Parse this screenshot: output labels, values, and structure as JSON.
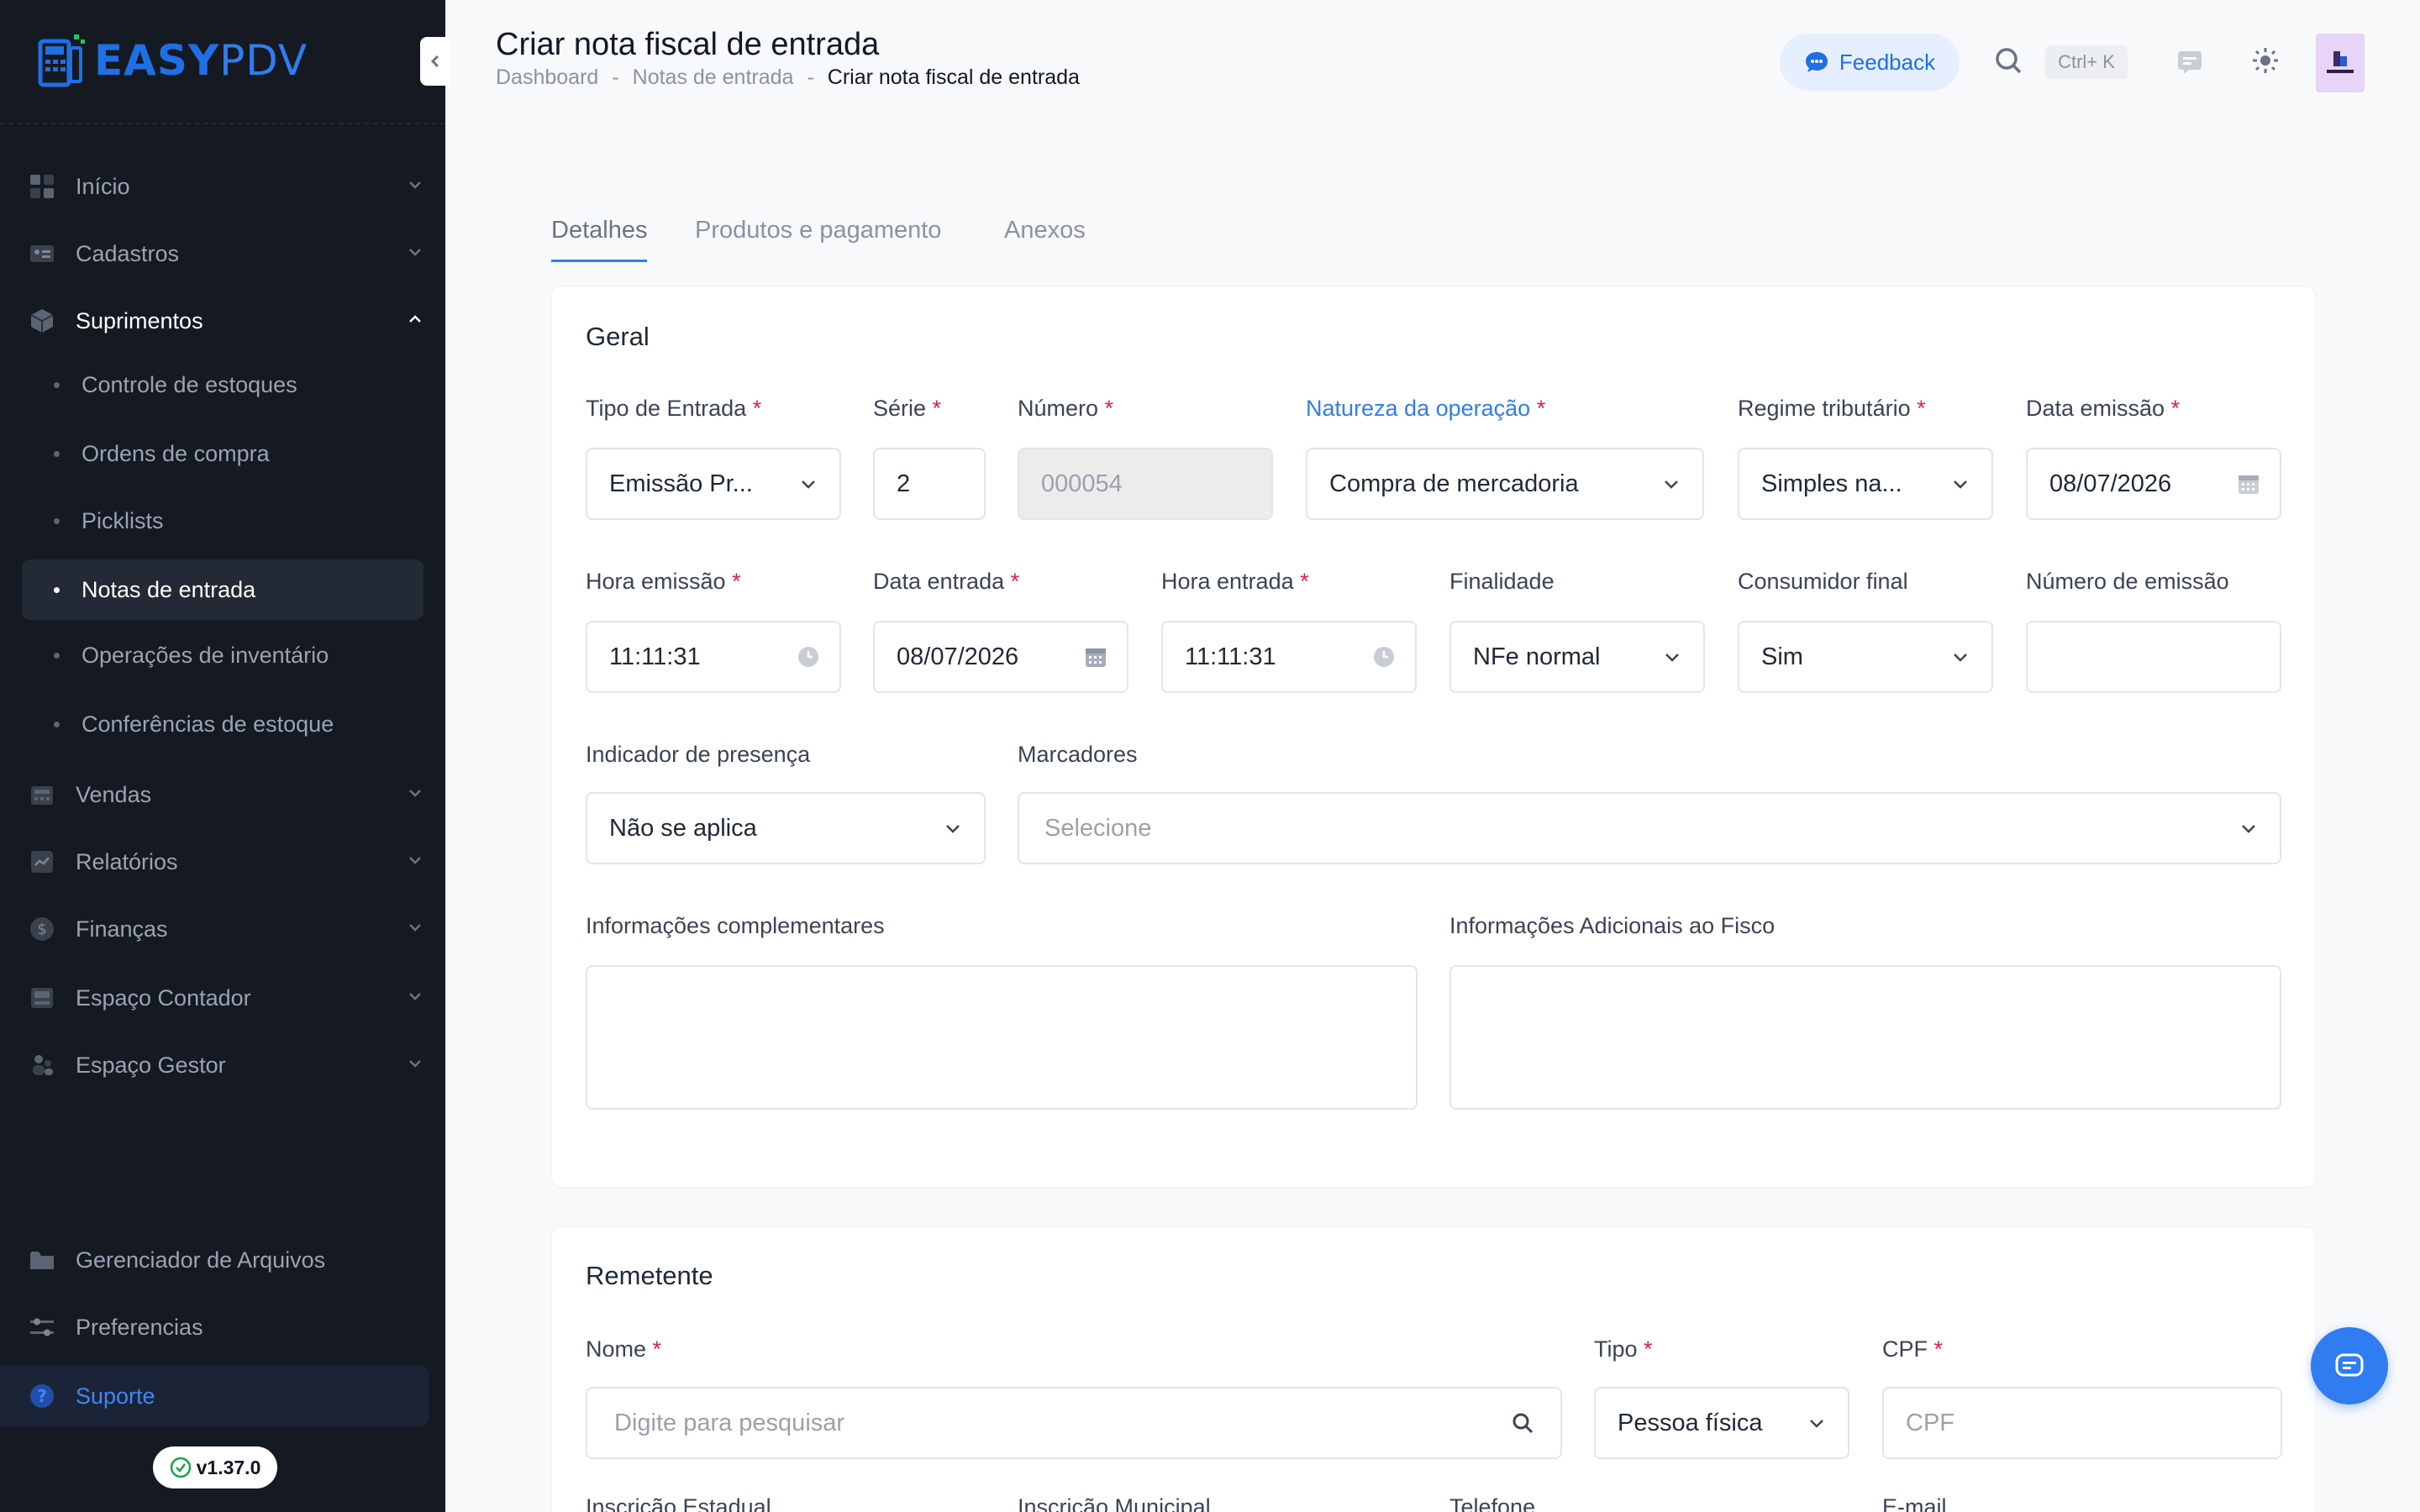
{
  "app": {
    "logo_main": "EASY",
    "logo_sub": "PDV",
    "version": "v1.37.0"
  },
  "header": {
    "title": "Criar nota fiscal de entrada",
    "breadcrumb": [
      "Dashboard",
      "Notas de entrada",
      "Criar nota fiscal de entrada"
    ],
    "separator": "-",
    "feedback": "Feedback",
    "shortcut": "Ctrl+ K"
  },
  "sidebar": {
    "items": [
      {
        "label": "Início",
        "icon": "grid-icon"
      },
      {
        "label": "Cadastros",
        "icon": "id-card-icon"
      },
      {
        "label": "Suprimentos",
        "icon": "box-icon"
      },
      {
        "label": "Vendas",
        "icon": "register-icon"
      },
      {
        "label": "Relatórios",
        "icon": "chart-icon"
      },
      {
        "label": "Finanças",
        "icon": "dollar-icon"
      },
      {
        "label": "Espaço Contador",
        "icon": "calculator-icon"
      },
      {
        "label": "Espaço Gestor",
        "icon": "people-icon"
      }
    ],
    "sub_items": [
      "Controle de estoques",
      "Ordens de compra",
      "Picklists",
      "Notas de entrada",
      "Operações de inventário",
      "Conferências de estoque"
    ],
    "bottom": [
      {
        "label": "Gerenciador de Arquivos",
        "icon": "folder-icon"
      },
      {
        "label": "Preferencias",
        "icon": "sliders-icon"
      }
    ],
    "support": "Suporte"
  },
  "tabs": [
    "Detalhes",
    "Produtos e pagamento",
    "Anexos"
  ],
  "geral": {
    "title": "Geral",
    "tipo_entrada": {
      "label": "Tipo de Entrada",
      "value": "Emissão Pr..."
    },
    "serie": {
      "label": "Série",
      "value": "2"
    },
    "numero": {
      "label": "Número",
      "value": "000054"
    },
    "natureza": {
      "label": "Natureza da operação",
      "value": "Compra de mercadoria"
    },
    "regime": {
      "label": "Regime tributário",
      "value": "Simples na..."
    },
    "data_emissao": {
      "label": "Data emissão",
      "value": "08/07/2026"
    },
    "hora_emissao": {
      "label": "Hora emissão",
      "value": "11:11:31"
    },
    "data_entrada": {
      "label": "Data entrada",
      "value": "08/07/2026"
    },
    "hora_entrada": {
      "label": "Hora entrada",
      "value": "11:11:31"
    },
    "finalidade": {
      "label": "Finalidade",
      "value": "NFe normal"
    },
    "consumidor": {
      "label": "Consumidor final",
      "value": "Sim"
    },
    "numero_emissao": {
      "label": "Número de emissão",
      "value": ""
    },
    "presenca": {
      "label": "Indicador de presença",
      "value": "Não se aplica"
    },
    "marcadores": {
      "label": "Marcadores",
      "placeholder": "Selecione"
    },
    "info_comp": {
      "label": "Informações complementares"
    },
    "info_fisco": {
      "label": "Informações Adicionais ao Fisco"
    }
  },
  "remetente": {
    "title": "Remetente",
    "nome": {
      "label": "Nome",
      "placeholder": "Digite para pesquisar"
    },
    "tipo": {
      "label": "Tipo",
      "value": "Pessoa física"
    },
    "cpf": {
      "label": "CPF",
      "placeholder": "CPF"
    },
    "ie": {
      "label": "Inscrição Estadual"
    },
    "im": {
      "label": "Inscrição Municipal"
    },
    "telefone": {
      "label": "Telefone"
    },
    "email": {
      "label": "E-mail"
    }
  },
  "required_mark": "*",
  "colors": {
    "accent": "#2f7df0",
    "sidebar_bg": "#151a22",
    "required": "#e11d48"
  }
}
